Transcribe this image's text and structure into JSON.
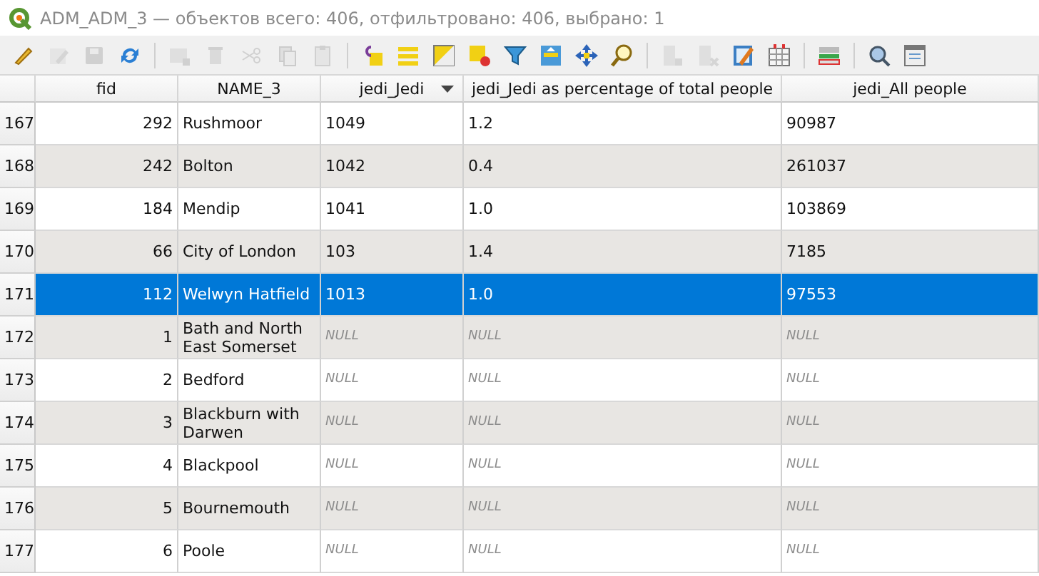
{
  "window": {
    "title": "ADM_ADM_3 — объектов всего: 406, отфильтровано: 406, выбрано: 1"
  },
  "toolbar": [
    {
      "kind": "pencil",
      "disabled": false
    },
    {
      "kind": "multi-edit",
      "disabled": true
    },
    {
      "kind": "save",
      "disabled": true
    },
    {
      "kind": "refresh",
      "disabled": false
    },
    {
      "kind": "separator"
    },
    {
      "kind": "add-row",
      "disabled": true
    },
    {
      "kind": "trash",
      "disabled": true
    },
    {
      "kind": "scissors",
      "disabled": true
    },
    {
      "kind": "copy",
      "disabled": true
    },
    {
      "kind": "paste",
      "disabled": true
    },
    {
      "kind": "separator"
    },
    {
      "kind": "expression-select",
      "disabled": false
    },
    {
      "kind": "select-all",
      "disabled": false
    },
    {
      "kind": "invert",
      "disabled": false
    },
    {
      "kind": "deselect",
      "disabled": false
    },
    {
      "kind": "filter",
      "disabled": false
    },
    {
      "kind": "move-top",
      "disabled": false
    },
    {
      "kind": "pan",
      "disabled": false
    },
    {
      "kind": "zoom",
      "disabled": false
    },
    {
      "kind": "separator"
    },
    {
      "kind": "new-field",
      "disabled": true
    },
    {
      "kind": "delete-field",
      "disabled": true
    },
    {
      "kind": "field-calc",
      "disabled": false
    },
    {
      "kind": "conditional",
      "disabled": false
    },
    {
      "kind": "separator"
    },
    {
      "kind": "dock",
      "disabled": false
    },
    {
      "kind": "separator"
    },
    {
      "kind": "actions",
      "disabled": false
    },
    {
      "kind": "form-view",
      "disabled": false
    }
  ],
  "table": {
    "columns": [
      {
        "label": "fid",
        "numeric": true,
        "sorted_descending": false
      },
      {
        "label": "NAME_3",
        "numeric": false,
        "sorted_descending": false
      },
      {
        "label": "jedi_Jedi",
        "numeric": false,
        "sorted_descending": true
      },
      {
        "label": "jedi_Jedi as percentage of total people",
        "numeric": false,
        "sorted_descending": false
      },
      {
        "label": "jedi_All people",
        "numeric": false,
        "sorted_descending": false
      }
    ],
    "rows": [
      {
        "header": "167",
        "selected": false,
        "cells": [
          {
            "text": "292",
            "null": false
          },
          {
            "text": "Rushmoor",
            "null": false
          },
          {
            "text": "1049",
            "null": false
          },
          {
            "text": "1.2",
            "null": false
          },
          {
            "text": "90987",
            "null": false
          }
        ]
      },
      {
        "header": "168",
        "selected": false,
        "cells": [
          {
            "text": "242",
            "null": false
          },
          {
            "text": "Bolton",
            "null": false
          },
          {
            "text": "1042",
            "null": false
          },
          {
            "text": "0.4",
            "null": false
          },
          {
            "text": "261037",
            "null": false
          }
        ]
      },
      {
        "header": "169",
        "selected": false,
        "cells": [
          {
            "text": "184",
            "null": false
          },
          {
            "text": "Mendip",
            "null": false
          },
          {
            "text": "1041",
            "null": false
          },
          {
            "text": "1.0",
            "null": false
          },
          {
            "text": "103869",
            "null": false
          }
        ]
      },
      {
        "header": "170",
        "selected": false,
        "cells": [
          {
            "text": "66",
            "null": false
          },
          {
            "text": "City of London",
            "null": false
          },
          {
            "text": "103",
            "null": false
          },
          {
            "text": "1.4",
            "null": false
          },
          {
            "text": "7185",
            "null": false
          }
        ]
      },
      {
        "header": "171",
        "selected": true,
        "cells": [
          {
            "text": "112",
            "null": false
          },
          {
            "text": "Welwyn Hatfield",
            "null": false
          },
          {
            "text": "1013",
            "null": false
          },
          {
            "text": "1.0",
            "null": false
          },
          {
            "text": "97553",
            "null": false
          }
        ]
      },
      {
        "header": "172",
        "selected": false,
        "cells": [
          {
            "text": "1",
            "null": false
          },
          {
            "text": "Bath and North East Somerset",
            "null": false
          },
          {
            "text": "NULL",
            "null": true
          },
          {
            "text": "NULL",
            "null": true
          },
          {
            "text": "NULL",
            "null": true
          }
        ]
      },
      {
        "header": "173",
        "selected": false,
        "cells": [
          {
            "text": "2",
            "null": false
          },
          {
            "text": "Bedford",
            "null": false
          },
          {
            "text": "NULL",
            "null": true
          },
          {
            "text": "NULL",
            "null": true
          },
          {
            "text": "NULL",
            "null": true
          }
        ]
      },
      {
        "header": "174",
        "selected": false,
        "cells": [
          {
            "text": "3",
            "null": false
          },
          {
            "text": "Blackburn with Darwen",
            "null": false
          },
          {
            "text": "NULL",
            "null": true
          },
          {
            "text": "NULL",
            "null": true
          },
          {
            "text": "NULL",
            "null": true
          }
        ]
      },
      {
        "header": "175",
        "selected": false,
        "cells": [
          {
            "text": "4",
            "null": false
          },
          {
            "text": "Blackpool",
            "null": false
          },
          {
            "text": "NULL",
            "null": true
          },
          {
            "text": "NULL",
            "null": true
          },
          {
            "text": "NULL",
            "null": true
          }
        ]
      },
      {
        "header": "176",
        "selected": false,
        "cells": [
          {
            "text": "5",
            "null": false
          },
          {
            "text": "Bournemouth",
            "null": false
          },
          {
            "text": "NULL",
            "null": true
          },
          {
            "text": "NULL",
            "null": true
          },
          {
            "text": "NULL",
            "null": true
          }
        ]
      },
      {
        "header": "177",
        "selected": false,
        "cells": [
          {
            "text": "6",
            "null": false
          },
          {
            "text": "Poole",
            "null": false
          },
          {
            "text": "NULL",
            "null": true
          },
          {
            "text": "NULL",
            "null": true
          },
          {
            "text": "NULL",
            "null": true
          }
        ]
      }
    ]
  }
}
